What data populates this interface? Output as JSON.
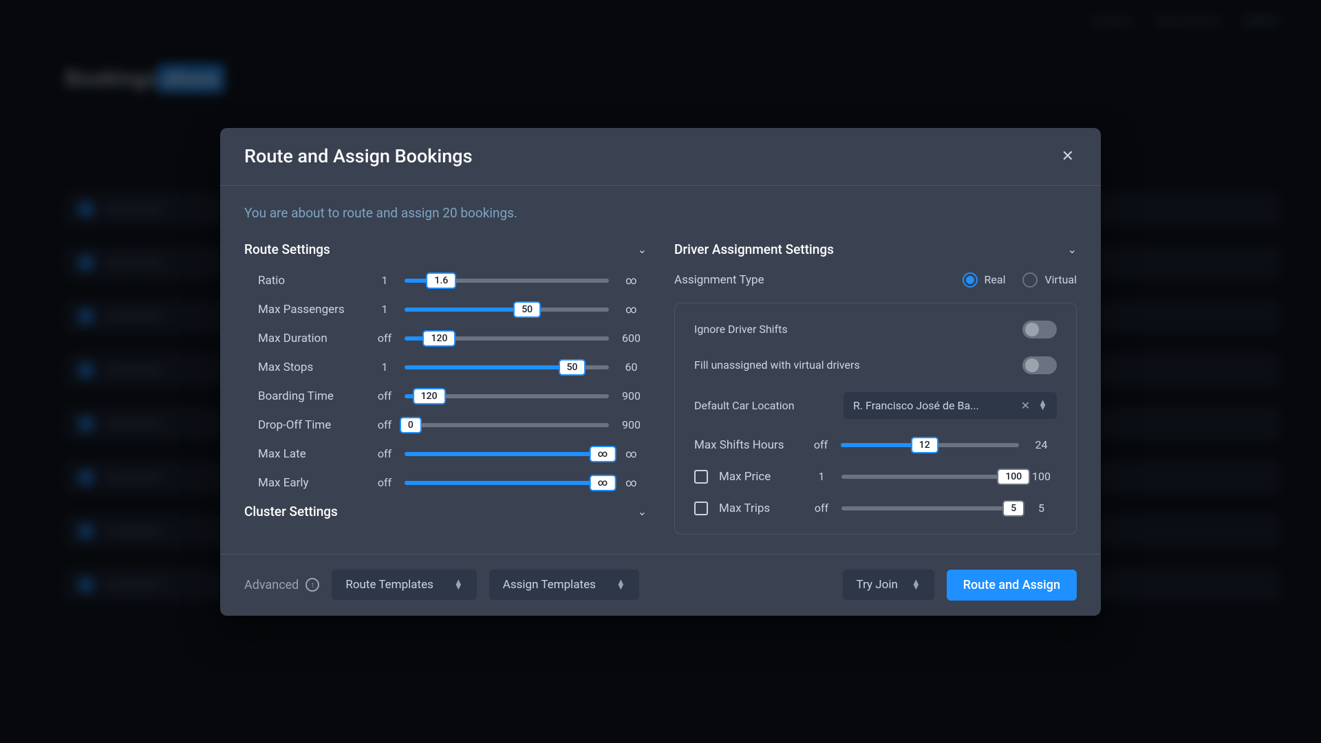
{
  "bg": {
    "title_a": "Bookings",
    "title_b": "shore",
    "logo": "optibus",
    "h1": "Optibus",
    "h2": "Marketplace"
  },
  "modal": {
    "title": "Route and Assign Bookings",
    "intro": "You are about to route and assign 20 bookings.",
    "route_section": "Route Settings",
    "cluster_section": "Cluster Settings",
    "driver_section": "Driver Assignment Settings",
    "sliders": {
      "ratio": {
        "label": "Ratio",
        "min": "1",
        "max": "∞",
        "value": "1.6",
        "pct": 18
      },
      "max_passengers": {
        "label": "Max Passengers",
        "min": "1",
        "max": "∞",
        "value": "50",
        "pct": 60
      },
      "max_duration": {
        "label": "Max Duration",
        "min": "off",
        "max": "600",
        "value": "120",
        "pct": 17
      },
      "max_stops": {
        "label": "Max Stops",
        "min": "1",
        "max": "60",
        "value": "50",
        "pct": 82
      },
      "boarding_time": {
        "label": "Boarding Time",
        "min": "off",
        "max": "900",
        "value": "120",
        "pct": 12
      },
      "drop_off_time": {
        "label": "Drop-Off Time",
        "min": "off",
        "max": "900",
        "value": "0",
        "pct": 3
      },
      "max_late": {
        "label": "Max Late",
        "min": "off",
        "max": "∞",
        "value": "∞",
        "pct": 97
      },
      "max_early": {
        "label": "Max Early",
        "min": "off",
        "max": "∞",
        "value": "∞",
        "pct": 97
      }
    },
    "assignment": {
      "label": "Assignment Type",
      "real": "Real",
      "virtual": "Virtual"
    },
    "driver": {
      "ignore_shifts": "Ignore Driver Shifts",
      "fill_virtual": "Fill unassigned with virtual drivers",
      "default_car": "Default Car Location",
      "car_value": "R. Francisco José de Ba...",
      "max_shifts": {
        "label": "Max Shifts Hours",
        "min": "off",
        "max": "24",
        "value": "12",
        "pct": 47
      },
      "max_price": {
        "label": "Max Price",
        "min": "1",
        "max": "100",
        "value": "100",
        "pct": 97
      },
      "max_trips": {
        "label": "Max Trips",
        "min": "off",
        "max": "5",
        "value": "5",
        "pct": 97
      }
    },
    "footer": {
      "advanced": "Advanced",
      "route_templates": "Route Templates",
      "assign_templates": "Assign Templates",
      "try_join": "Try Join",
      "primary": "Route and Assign"
    }
  }
}
